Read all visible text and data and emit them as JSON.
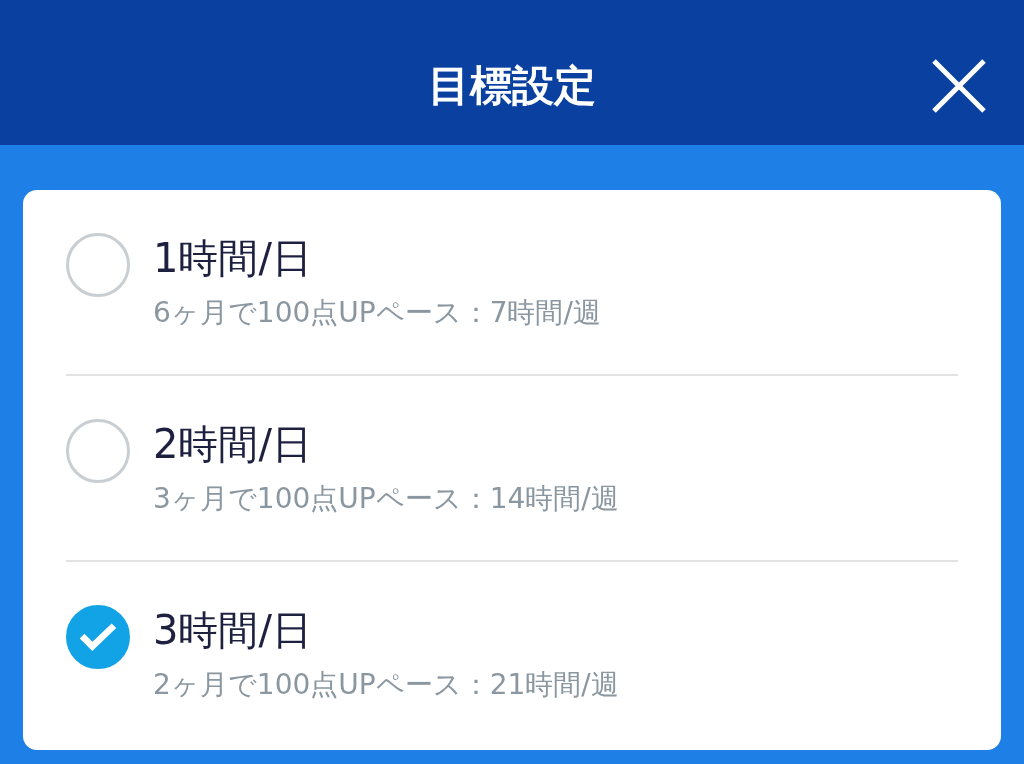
{
  "header": {
    "title": "目標設定"
  },
  "options": [
    {
      "label": "1時間/日",
      "description": "6ヶ月で100点UPペース：7時間/週",
      "selected": false
    },
    {
      "label": "2時間/日",
      "description": "3ヶ月で100点UPペース：14時間/週",
      "selected": false
    },
    {
      "label": "3時間/日",
      "description": "2ヶ月で100点UPペース：21時間/週",
      "selected": true
    }
  ]
}
